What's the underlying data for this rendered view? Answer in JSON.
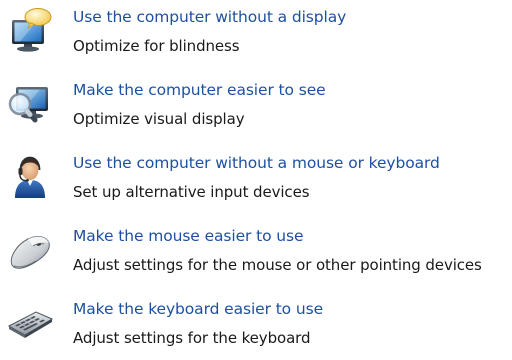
{
  "items": [
    {
      "link": "Use the computer without a display",
      "description": "Optimize for blindness",
      "icon": "monitor-speech-icon"
    },
    {
      "link": "Make the computer easier to see",
      "description": "Optimize visual display",
      "icon": "monitor-magnifier-icon"
    },
    {
      "link": "Use the computer without a mouse or keyboard",
      "description": "Set up alternative input devices",
      "icon": "person-headset-icon"
    },
    {
      "link": "Make the mouse easier to use",
      "description": "Adjust settings for the mouse or other pointing devices",
      "icon": "mouse-icon"
    },
    {
      "link": "Make the keyboard easier to use",
      "description": "Adjust settings for the keyboard",
      "icon": "keyboard-icon"
    }
  ],
  "colors": {
    "link": "#1e50a2",
    "text": "#1a1a1a",
    "background": "#ffffff"
  }
}
